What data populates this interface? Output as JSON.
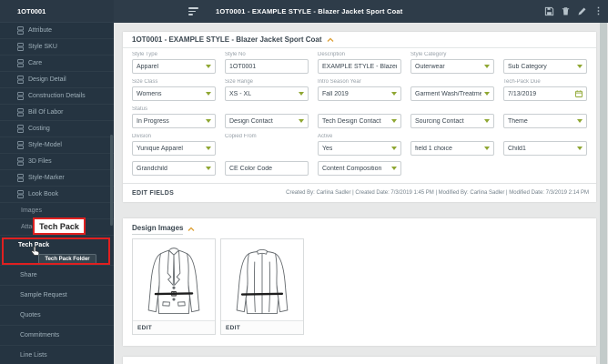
{
  "topbar": {
    "title": "1OT0001 - EXAMPLE STYLE - Blazer Jacket Sport Coat",
    "icons": {
      "menu": "sort-lines",
      "save": "floppy-disk",
      "delete": "trash",
      "edit": "pencil",
      "more": "kebab-menu"
    }
  },
  "sidebar": {
    "header": "1OT0001",
    "sub_items": [
      "Attribute",
      "Style SKU",
      "Care",
      "Design Detail",
      "Construction Details",
      "Bill Of Labor",
      "Costing",
      "Style-Model",
      "3D Files",
      "Style-Marker",
      "Look Book"
    ],
    "group_items": [
      "Images",
      "Attachments"
    ],
    "tech_pack_item": "Tech Pack",
    "bottom_items": [
      "Share",
      "Sample Request",
      "Quotes",
      "Commitments",
      "Line Lists"
    ],
    "annotation": {
      "label": "Tech Pack",
      "tooltip": "Tech Pack Folder"
    }
  },
  "style_panel": {
    "title": "1OT0001 - EXAMPLE STYLE - Blazer Jacket Sport Coat",
    "rows": [
      [
        {
          "label": "Style Type",
          "value": "Apparel",
          "control": "select"
        },
        {
          "label": "Style No",
          "value": "1OT0001",
          "control": "text"
        },
        {
          "label": "Description",
          "value": "EXAMPLE STYLE - Blazer Jacke",
          "control": "text"
        },
        {
          "label": "Style Category",
          "value": "Outerwear",
          "control": "select"
        },
        {
          "label": "",
          "value": "Sub Category",
          "control": "select",
          "placeholder": true
        }
      ],
      [
        {
          "label": "Size Class",
          "value": "Womens",
          "control": "select"
        },
        {
          "label": "Size Range",
          "value": "XS - XL",
          "control": "select"
        },
        {
          "label": "Intro Season Year",
          "value": "Fall 2019",
          "control": "select"
        },
        {
          "label": "",
          "value": "Garment Wash/Treatment",
          "control": "select",
          "placeholder": true
        },
        {
          "label": "Tech-Pack Due",
          "value": "7/13/2019",
          "control": "date"
        }
      ],
      [
        {
          "label": "Status",
          "value": "In Progress",
          "control": "select"
        },
        {
          "label": "",
          "value": "Design Contact",
          "control": "select",
          "placeholder": true
        },
        {
          "label": "",
          "value": "Tech Design Contact",
          "control": "select",
          "placeholder": true
        },
        {
          "label": "",
          "value": "Sourcing Contact",
          "control": "select",
          "placeholder": true
        },
        {
          "label": "",
          "value": "Theme",
          "control": "select",
          "placeholder": true
        }
      ],
      [
        {
          "label": "Division",
          "value": "Yunique Apparel",
          "control": "select"
        },
        {
          "label": "Copied From",
          "value": "",
          "control": "none"
        },
        {
          "label": "Active",
          "value": "Yes",
          "control": "select"
        },
        {
          "label": "",
          "value": "field 1 choice",
          "control": "select",
          "placeholder": true
        },
        {
          "label": "",
          "value": "Child1",
          "control": "select",
          "placeholder": true
        }
      ],
      [
        {
          "label": "",
          "value": "Grandchild",
          "control": "select",
          "placeholder": true
        },
        {
          "label": "",
          "value": "CE Color Code",
          "control": "text",
          "placeholder": true
        },
        {
          "label": "",
          "value": "Content Composition",
          "control": "select",
          "placeholder": true
        },
        {
          "label": "",
          "value": "",
          "control": "empty"
        },
        {
          "label": "",
          "value": "",
          "control": "empty"
        }
      ]
    ],
    "edit_fields_label": "EDIT FIELDS",
    "meta": "Created By: Carlina Sadler | Created Date: 7/3/2019 1:45 PM | Modified By: Carlina Sadler | Modified Date: 7/3/2019 2:14 PM"
  },
  "design_images_panel": {
    "title": "Design Images",
    "cards": [
      {
        "edit_label": "EDIT",
        "image": "blazer-front-sketch"
      },
      {
        "edit_label": "EDIT",
        "image": "blazer-back-sketch"
      }
    ]
  },
  "colors": {
    "accent_green": "#8fa733",
    "chevron_orange": "#dfa43c",
    "highlight_red": "#e02020",
    "sidebar_bg": "#253441",
    "topbar_bg": "#2e3c49"
  }
}
